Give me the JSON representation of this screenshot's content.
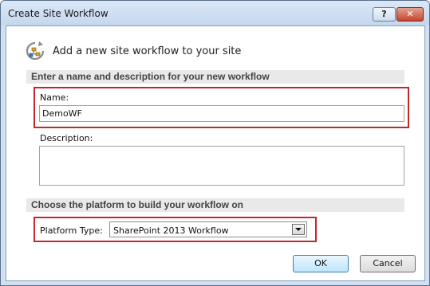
{
  "window": {
    "title": "Create Site Workflow",
    "help_glyph": "?",
    "close_glyph": "✕"
  },
  "header": {
    "text": "Add a new site workflow to your site",
    "icon": "workflow-icon"
  },
  "section_name": {
    "title": "Enter a name and description for your new workflow",
    "name_label": "Name:",
    "name_value": "DemoWF",
    "description_label": "Description:",
    "description_value": ""
  },
  "section_platform": {
    "title": "Choose the platform to build your workflow on",
    "platform_label": "Platform Type:",
    "platform_value": "SharePoint 2013 Workflow"
  },
  "buttons": {
    "ok": "OK",
    "cancel": "Cancel"
  },
  "colors": {
    "highlight": "#c1272d",
    "titlebar": "#cfe0f2",
    "section_bar": "#e9e9e9"
  }
}
